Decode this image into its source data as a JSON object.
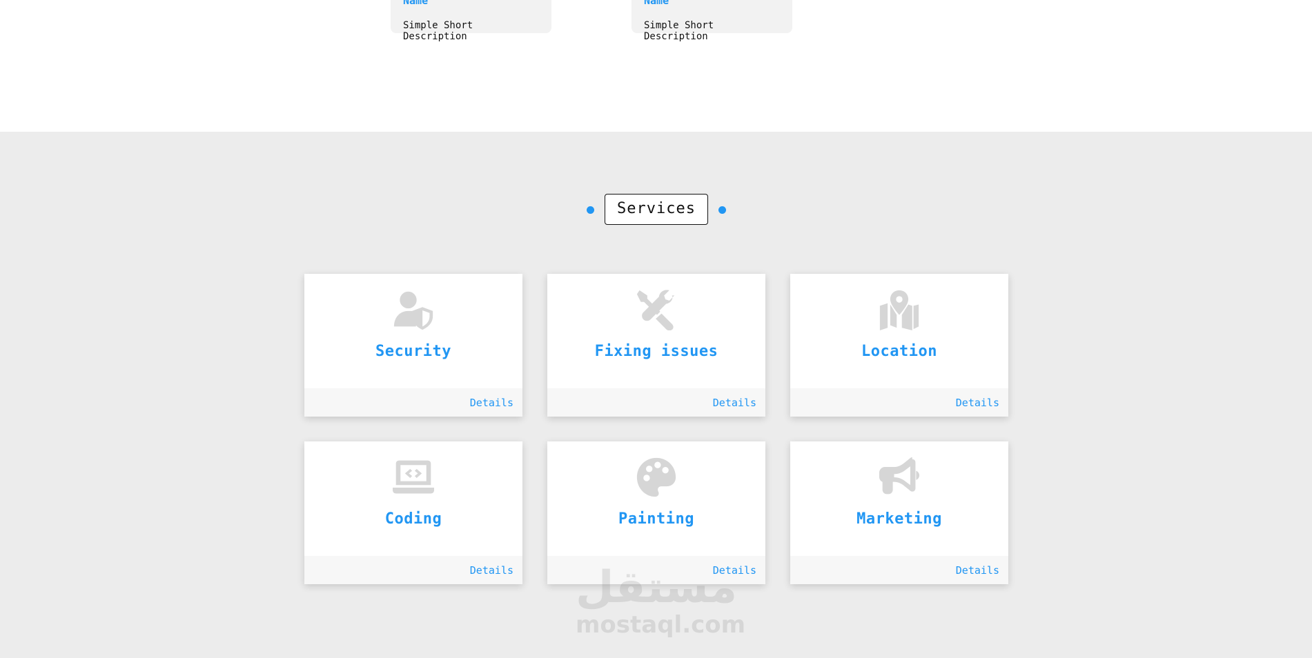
{
  "team": {
    "members": [
      {
        "name": "Name",
        "description": "Simple Short Description"
      },
      {
        "name": "Name",
        "description": "Simple Short Description"
      }
    ]
  },
  "services": {
    "title": "Services",
    "accent_color": "#2196f3",
    "items": [
      {
        "title": "Security",
        "icon": "user-shield-icon",
        "details_label": "Details"
      },
      {
        "title": "Fixing issues",
        "icon": "tools-icon",
        "details_label": "Details"
      },
      {
        "title": "Location",
        "icon": "map-location-icon",
        "details_label": "Details"
      },
      {
        "title": "Coding",
        "icon": "laptop-code-icon",
        "details_label": "Details"
      },
      {
        "title": "Painting",
        "icon": "palette-icon",
        "details_label": "Details"
      },
      {
        "title": "Marketing",
        "icon": "bullhorn-icon",
        "details_label": "Details"
      }
    ]
  },
  "watermark": {
    "logo": "مستقل",
    "site": "mostaql.com"
  }
}
